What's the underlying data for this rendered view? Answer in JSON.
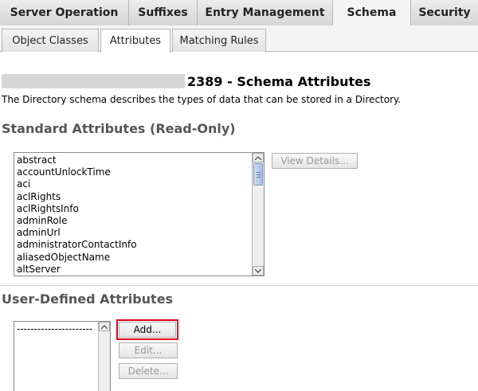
{
  "top_tabs": [
    {
      "label": "Server Operation",
      "active": false
    },
    {
      "label": "Suffixes",
      "active": false
    },
    {
      "label": "Entry Management",
      "active": false
    },
    {
      "label": "Schema",
      "active": true
    },
    {
      "label": "Security",
      "active": false
    }
  ],
  "sub_tabs": [
    {
      "label": "Object Classes",
      "active": false
    },
    {
      "label": "Attributes",
      "active": true
    },
    {
      "label": "Matching Rules",
      "active": false
    }
  ],
  "page": {
    "title": "2389 - Schema Attributes",
    "description": "The Directory schema describes the types of data that can be stored in a Directory."
  },
  "standard": {
    "heading": "Standard Attributes (Read-Only)",
    "items": [
      "abstract",
      "accountUnlockTime",
      "aci",
      "aclRights",
      "aclRightsInfo",
      "adminRole",
      "adminUrl",
      "administratorContactInfo",
      "aliasedObjectName",
      "altServer"
    ],
    "view_details_label": "View Details..."
  },
  "user_defined": {
    "heading": "User-Defined Attributes",
    "items": [
      "----------------------"
    ],
    "add_label": "Add...",
    "edit_label": "Edit...",
    "delete_label": "Delete..."
  },
  "colors": {
    "highlight": "#e1001b",
    "scroll_thumb": "#a9c0e6"
  }
}
